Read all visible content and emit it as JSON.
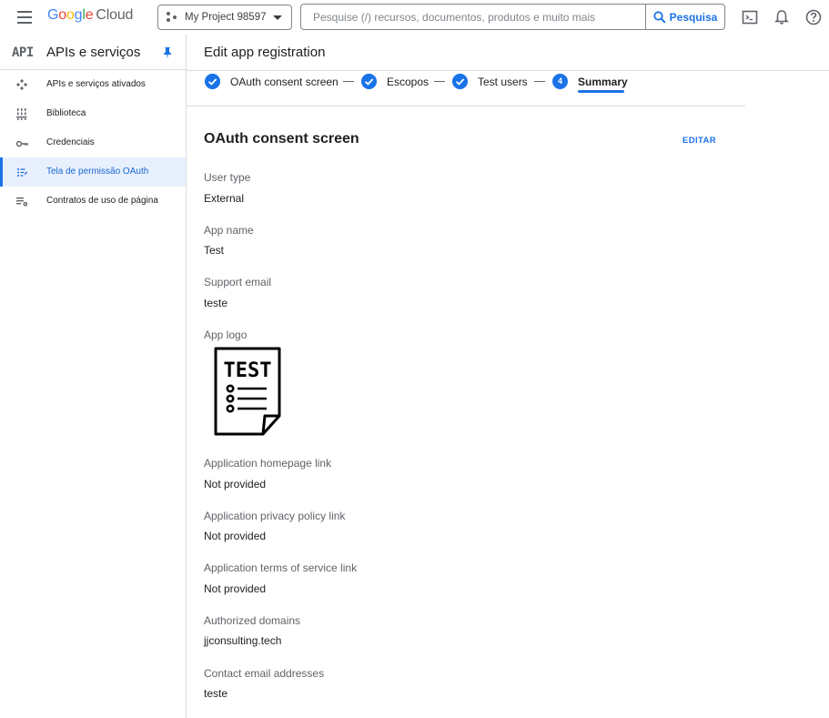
{
  "topbar": {
    "logo_letters": [
      "G",
      "o",
      "o",
      "g",
      "l",
      "e"
    ],
    "logo_cloud": "Cloud",
    "project_name": "My Project 98597",
    "search_placeholder": "Pesquise (/) recursos, documentos, produtos e muito mais",
    "search_button": "Pesquisa",
    "icons": [
      "terminal-icon",
      "bell-icon",
      "help-icon"
    ]
  },
  "sidebar": {
    "badge": "API",
    "title": "APIs e serviços",
    "items": [
      {
        "label": "APIs e serviços ativados",
        "icon": "apis-icon",
        "active": false
      },
      {
        "label": "Biblioteca",
        "icon": "library-icon",
        "active": false
      },
      {
        "label": "Credenciais",
        "icon": "key-icon",
        "active": false
      },
      {
        "label": "Tela de permissão OAuth",
        "icon": "consent-icon",
        "active": true
      },
      {
        "label": "Contratos de uso de página",
        "icon": "agreements-icon",
        "active": false
      }
    ]
  },
  "header": {
    "title": "Edit app registration"
  },
  "stepper": {
    "steps": [
      {
        "label": "OAuth consent screen",
        "state": "done"
      },
      {
        "label": "Escopos",
        "state": "done"
      },
      {
        "label": "Test users",
        "state": "done"
      },
      {
        "label": "Summary",
        "state": "current",
        "number": "4"
      }
    ]
  },
  "summary": {
    "section_title": "OAuth consent screen",
    "edit_label": "EDITAR",
    "fields": [
      {
        "label": "User type",
        "value": "External"
      },
      {
        "label": "App name",
        "value": "Test"
      },
      {
        "label": "Support email",
        "value": "teste"
      },
      {
        "label": "App logo",
        "value": "TEST"
      },
      {
        "label": "Application homepage link",
        "value": "Not provided"
      },
      {
        "label": "Application privacy policy link",
        "value": "Not provided"
      },
      {
        "label": "Application terms of service link",
        "value": "Not provided"
      },
      {
        "label": "Authorized domains",
        "value": "jjconsulting.tech"
      },
      {
        "label": "Contact email addresses",
        "value": "teste"
      }
    ]
  },
  "colors": {
    "accent": "#1a73e8",
    "active_bg": "#e8f0fe",
    "border": "#dadce0"
  }
}
